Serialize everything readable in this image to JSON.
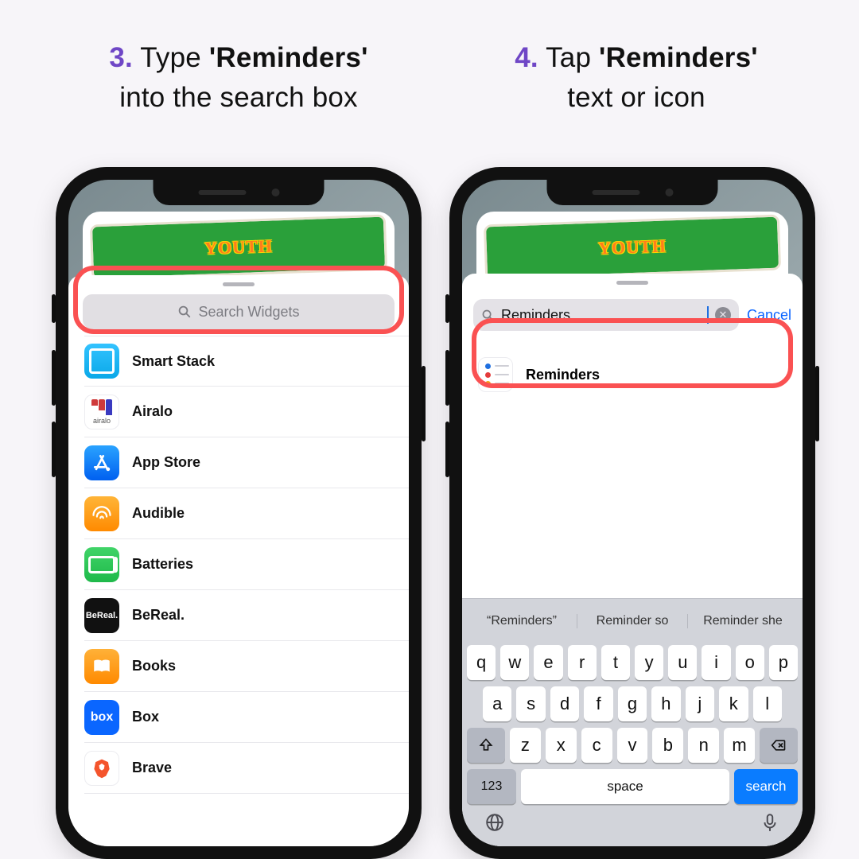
{
  "step3": {
    "num": "3.",
    "text_a": "Type ",
    "bold": "'Reminders'",
    "text_b": "into the search box"
  },
  "step4": {
    "num": "4.",
    "text_a": "Tap ",
    "bold": "'Reminders'",
    "text_b": "text or icon"
  },
  "left": {
    "search_placeholder": "Search Widgets",
    "wallpaper_banner": "YOUTH",
    "widgets": [
      {
        "label": "Smart Stack",
        "icon": "smart-stack-icon"
      },
      {
        "label": "Airalo",
        "icon": "airalo-icon",
        "sub": "airalo"
      },
      {
        "label": "App Store",
        "icon": "app-store-icon"
      },
      {
        "label": "Audible",
        "icon": "audible-icon"
      },
      {
        "label": "Batteries",
        "icon": "batteries-icon"
      },
      {
        "label": "BeReal.",
        "icon": "bereal-icon",
        "glyph": "BeReal."
      },
      {
        "label": "Books",
        "icon": "books-icon"
      },
      {
        "label": "Box",
        "icon": "box-icon",
        "glyph": "box"
      },
      {
        "label": "Brave",
        "icon": "brave-icon"
      }
    ]
  },
  "right": {
    "search_value": "Reminders",
    "cancel_label": "Cancel",
    "result_label": "Reminders",
    "wallpaper_banner": "YOUTH",
    "suggestions": [
      "“Reminders”",
      "Reminder so",
      "Reminder she"
    ],
    "row1": [
      "q",
      "w",
      "e",
      "r",
      "t",
      "y",
      "u",
      "i",
      "o",
      "p"
    ],
    "row2": [
      "a",
      "s",
      "d",
      "f",
      "g",
      "h",
      "j",
      "k",
      "l"
    ],
    "row3": [
      "z",
      "x",
      "c",
      "v",
      "b",
      "n",
      "m"
    ],
    "key_123": "123",
    "key_space": "space",
    "key_search": "search"
  },
  "colors": {
    "highlight": "#FA5152",
    "accent_purple": "#6F46C6",
    "ios_blue": "#0A64FF"
  }
}
